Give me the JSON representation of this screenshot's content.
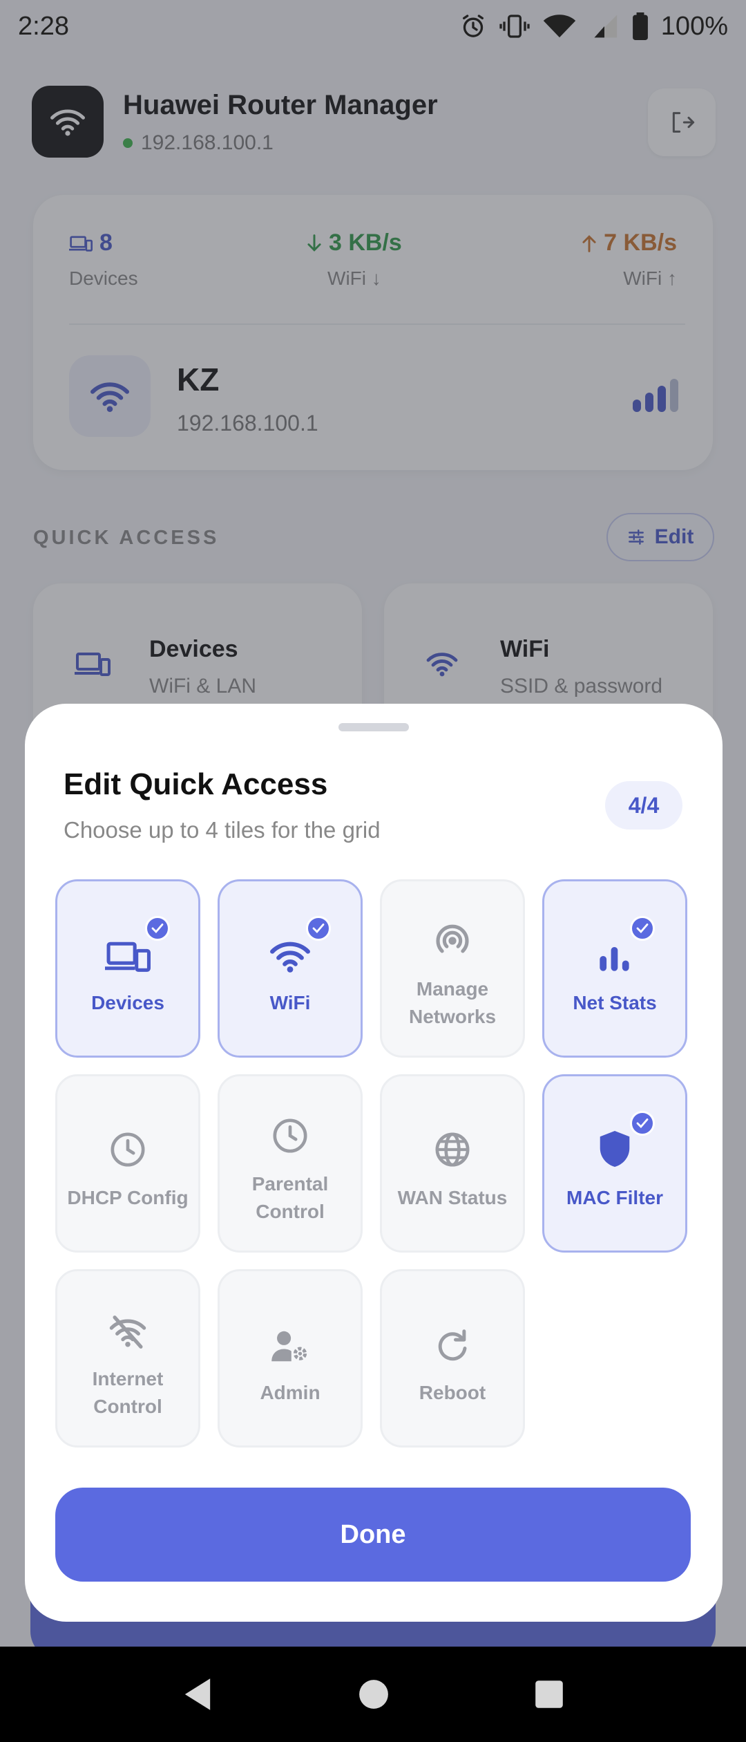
{
  "status_bar": {
    "time": "2:28",
    "battery": "100%"
  },
  "app": {
    "title": "Huawei Router Manager",
    "ip": "192.168.100.1",
    "stats": [
      {
        "value": "8",
        "label": "Devices"
      },
      {
        "value": "3 KB/s",
        "label": "WiFi ↓"
      },
      {
        "value": "7 KB/s",
        "label": "WiFi ↑"
      }
    ],
    "network": {
      "name": "KZ",
      "ip": "192.168.100.1"
    },
    "quick_access": {
      "label": "QUICK ACCESS",
      "edit_label": "Edit",
      "tiles": [
        {
          "title": "Devices",
          "subtitle": "WiFi & LAN"
        },
        {
          "title": "WiFi",
          "subtitle": "SSID & password"
        }
      ]
    }
  },
  "sheet": {
    "title": "Edit Quick Access",
    "subtitle": "Choose up to 4 tiles for the grid",
    "count": "4/4",
    "tiles": [
      {
        "label": "Devices",
        "icon": "devices-icon",
        "selected": true
      },
      {
        "label": "WiFi",
        "icon": "wifi-icon",
        "selected": true
      },
      {
        "label": "Manage Networks",
        "icon": "broadcast-icon",
        "selected": false
      },
      {
        "label": "Net Stats",
        "icon": "bar-chart-icon",
        "selected": true
      },
      {
        "label": "DHCP Config",
        "icon": "clock-icon",
        "selected": false
      },
      {
        "label": "Parental Control",
        "icon": "clock-icon",
        "selected": false
      },
      {
        "label": "WAN Status",
        "icon": "globe-icon",
        "selected": false
      },
      {
        "label": "MAC Filter",
        "icon": "shield-icon",
        "selected": true
      },
      {
        "label": "Internet Control",
        "icon": "wifi-off-icon",
        "selected": false
      },
      {
        "label": "Admin",
        "icon": "admin-gear-icon",
        "selected": false
      },
      {
        "label": "Reboot",
        "icon": "refresh-icon",
        "selected": false
      }
    ],
    "done_label": "Done"
  },
  "colors": {
    "accent": "#5b6ae0",
    "accent_text": "#4858c8",
    "green": "#2f9a47",
    "orange": "#c8742c"
  }
}
